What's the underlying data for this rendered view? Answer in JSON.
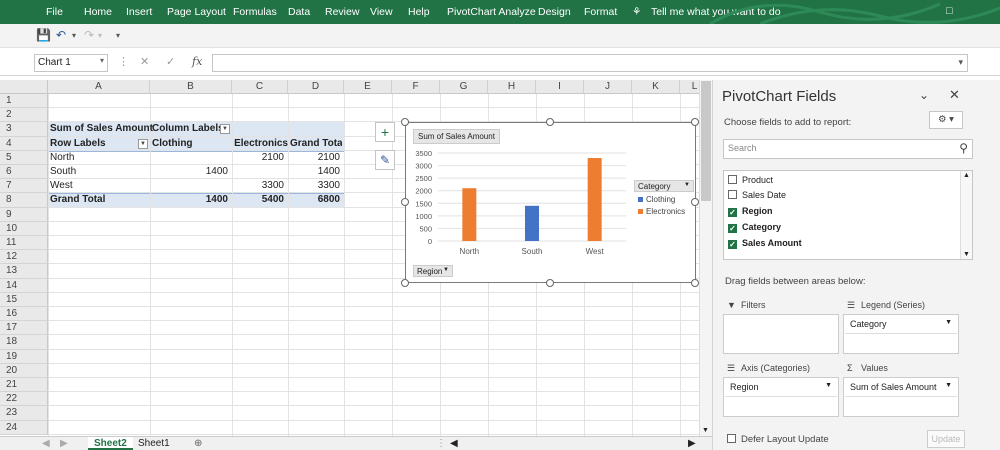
{
  "ribbon": {
    "tabs": [
      "File",
      "Home",
      "Insert",
      "Page Layout",
      "Formulas",
      "Data",
      "Review",
      "View",
      "Help",
      "PivotChart Analyze",
      "Design",
      "Format"
    ],
    "tell_me": "Tell me what you want to do"
  },
  "formula_bar": {
    "name_box": "Chart 1",
    "fx": "fx",
    "formula": ""
  },
  "sheet": {
    "columns": [
      "A",
      "B",
      "C",
      "D",
      "E",
      "F",
      "G",
      "H",
      "I",
      "J",
      "K",
      "L"
    ],
    "rows": [
      "1",
      "2",
      "3",
      "4",
      "5",
      "6",
      "7",
      "8",
      "9",
      "10",
      "11",
      "12",
      "13",
      "14",
      "15",
      "16",
      "17",
      "18",
      "19",
      "20",
      "21",
      "22",
      "23",
      "24"
    ],
    "pivot": {
      "value_header": "Sum of Sales Amount",
      "col_labels": "Column Labels",
      "row_labels": "Row Labels",
      "col_items": [
        "Clothing",
        "Electronics",
        "Grand Total"
      ],
      "rows": [
        {
          "label": "North",
          "clothing": "",
          "electronics": "2100",
          "total": "2100"
        },
        {
          "label": "South",
          "clothing": "1400",
          "electronics": "",
          "total": "1400"
        },
        {
          "label": "West",
          "clothing": "",
          "electronics": "3300",
          "total": "3300"
        }
      ],
      "grand_total": {
        "label": "Grand Total",
        "clothing": "1400",
        "electronics": "5400",
        "total": "6800"
      }
    },
    "tabs": [
      "Sheet2",
      "Sheet1"
    ]
  },
  "chart_data": {
    "type": "bar",
    "title": "Sum of Sales Amount",
    "categories": [
      "North",
      "South",
      "West"
    ],
    "series": [
      {
        "name": "Clothing",
        "values": [
          0,
          1400,
          0
        ],
        "color": "#4472c4"
      },
      {
        "name": "Electronics",
        "values": [
          2100,
          0,
          3300
        ],
        "color": "#ed7d31"
      }
    ],
    "yticks": [
      "3500",
      "3000",
      "2500",
      "2000",
      "1500",
      "1000",
      "500",
      "0"
    ],
    "ylim": [
      0,
      3500
    ],
    "legend_title": "Category",
    "axis_button": "Region",
    "grid": true,
    "legend_position": "right"
  },
  "panel": {
    "title": "PivotChart Fields",
    "choose_label": "Choose fields to add to report:",
    "search_placeholder": "Search",
    "fields": [
      {
        "name": "Product",
        "checked": false
      },
      {
        "name": "Sales Date",
        "checked": false
      },
      {
        "name": "Region",
        "checked": true
      },
      {
        "name": "Category",
        "checked": true
      },
      {
        "name": "Sales Amount",
        "checked": true
      }
    ],
    "drag_label": "Drag fields between areas below:",
    "filters_label": "Filters",
    "legend_label": "Legend (Series)",
    "legend_item": "Category",
    "axis_label": "Axis (Categories)",
    "axis_item": "Region",
    "values_label": "Values",
    "values_item": "Sum of Sales Amount",
    "defer_label": "Defer Layout Update",
    "update_label": "Update"
  }
}
